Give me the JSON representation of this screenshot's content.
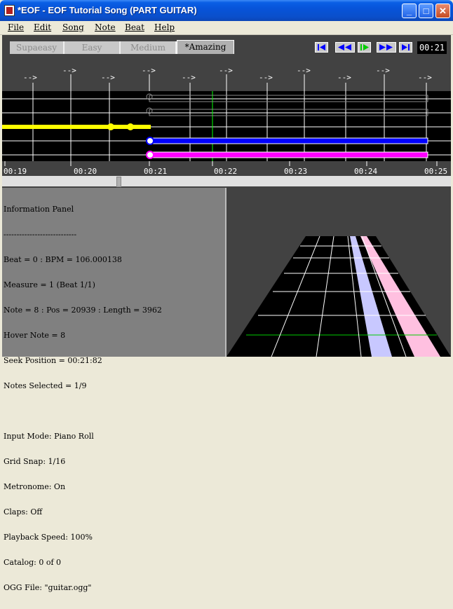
{
  "window": {
    "title": "*EOF - EOF Tutorial Song (PART GUITAR)"
  },
  "menu": [
    "File",
    "Edit",
    "Song",
    "Note",
    "Beat",
    "Help"
  ],
  "difficulty_tabs": [
    {
      "label": "Supaeasy",
      "active": false
    },
    {
      "label": "Easy",
      "active": false
    },
    {
      "label": "Medium",
      "active": false
    },
    {
      "label": "*Amazing",
      "active": true
    }
  ],
  "transport": {
    "buttons": [
      "seek-start",
      "rewind",
      "play",
      "fast-forward",
      "seek-end"
    ],
    "time": "00:21"
  },
  "timeline": {
    "beat_markers": [
      "-->",
      "-->",
      "-->",
      "-->",
      "-->",
      "-->",
      "-->",
      "-->",
      "-->",
      "-->",
      "-->"
    ],
    "time_labels": [
      "00:19",
      "00:20",
      "00:21",
      "00:22",
      "00:23",
      "00:24",
      "00:25"
    ]
  },
  "colors": {
    "yellow_note": "#ffff00",
    "blue_note": "#0000ff",
    "pink_note": "#ff00ff",
    "panel_bg": "#424242",
    "highway": "#000000",
    "grid": "#ffffff"
  },
  "info_panel": {
    "title": "Information Panel",
    "divider": "----------------------------",
    "lines": [
      "Beat = 0 : BPM = 106.000138",
      "Measure = 1 (Beat 1/1)",
      "Note = 8 : Pos = 20939 : Length = 3962",
      "Hover Note = 8",
      "Seek Position = 00:21:82",
      "Notes Selected = 1/9",
      "",
      "Input Mode: Piano Roll",
      "Grid Snap: 1/16",
      "Metronome: On",
      "Claps: Off",
      "Playback Speed: 100%",
      "Catalog: 0 of 0",
      "OGG File: \"guitar.ogg\""
    ]
  }
}
